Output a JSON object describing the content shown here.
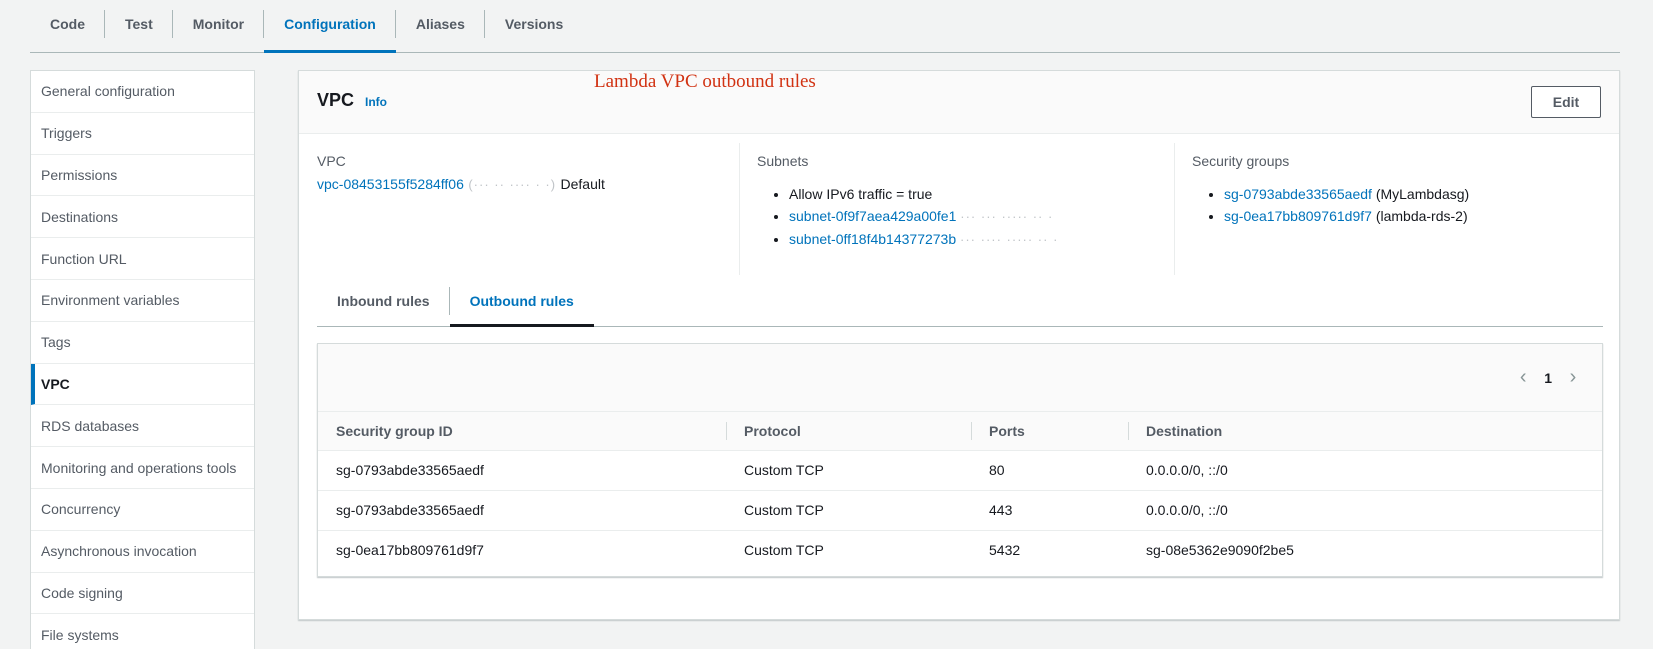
{
  "top_tabs": [
    {
      "label": "Code"
    },
    {
      "label": "Test"
    },
    {
      "label": "Monitor"
    },
    {
      "label": "Configuration",
      "active": true
    },
    {
      "label": "Aliases"
    },
    {
      "label": "Versions"
    }
  ],
  "sidebar": {
    "items": [
      {
        "label": "General configuration"
      },
      {
        "label": "Triggers"
      },
      {
        "label": "Permissions"
      },
      {
        "label": "Destinations"
      },
      {
        "label": "Function URL"
      },
      {
        "label": "Environment variables"
      },
      {
        "label": "Tags"
      },
      {
        "label": "VPC",
        "active": true
      },
      {
        "label": "RDS databases"
      },
      {
        "label": "Monitoring and operations tools"
      },
      {
        "label": "Concurrency"
      },
      {
        "label": "Asynchronous invocation"
      },
      {
        "label": "Code signing"
      },
      {
        "label": "File systems"
      }
    ]
  },
  "panel": {
    "title": "VPC",
    "info": "Info",
    "annotation": "Lambda VPC outbound rules",
    "edit_label": "Edit",
    "vpc": {
      "label": "VPC",
      "id": "vpc-08453155f5284ff06",
      "redacted": "(··· ·· ···· · ·)",
      "suffix": "Default"
    },
    "subnets": {
      "label": "Subnets",
      "ipv6": "Allow IPv6 traffic = true",
      "items": [
        {
          "id": "subnet-0f9f7aea429a00fe1",
          "redacted": "··· ··· ····· ·· ·"
        },
        {
          "id": "subnet-0ff18f4b14377273b",
          "redacted": "··· ···· ····· ·· ·"
        }
      ]
    },
    "security_groups": {
      "label": "Security groups",
      "items": [
        {
          "id": "sg-0793abde33565aedf",
          "name": "(MyLambdasg)"
        },
        {
          "id": "sg-0ea17bb809761d9f7",
          "name": "(lambda-rds-2)"
        }
      ]
    },
    "rule_tabs": [
      {
        "label": "Inbound rules"
      },
      {
        "label": "Outbound rules",
        "active": true
      }
    ],
    "pager": {
      "page": "1",
      "prev_icon": "chevron-left-icon",
      "next_icon": "chevron-right-icon"
    },
    "table": {
      "headers": [
        "Security group ID",
        "Protocol",
        "Ports",
        "Destination"
      ],
      "rows": [
        [
          "sg-0793abde33565aedf",
          "Custom TCP",
          "80",
          "0.0.0.0/0, ::/0"
        ],
        [
          "sg-0793abde33565aedf",
          "Custom TCP",
          "443",
          "0.0.0.0/0, ::/0"
        ],
        [
          "sg-0ea17bb809761d9f7",
          "Custom TCP",
          "5432",
          "sg-08e5362e9090f2be5"
        ]
      ]
    }
  },
  "colors": {
    "accent": "#0073bb",
    "annotation": "#d13212",
    "text": "#16191f",
    "muted": "#545b64"
  }
}
